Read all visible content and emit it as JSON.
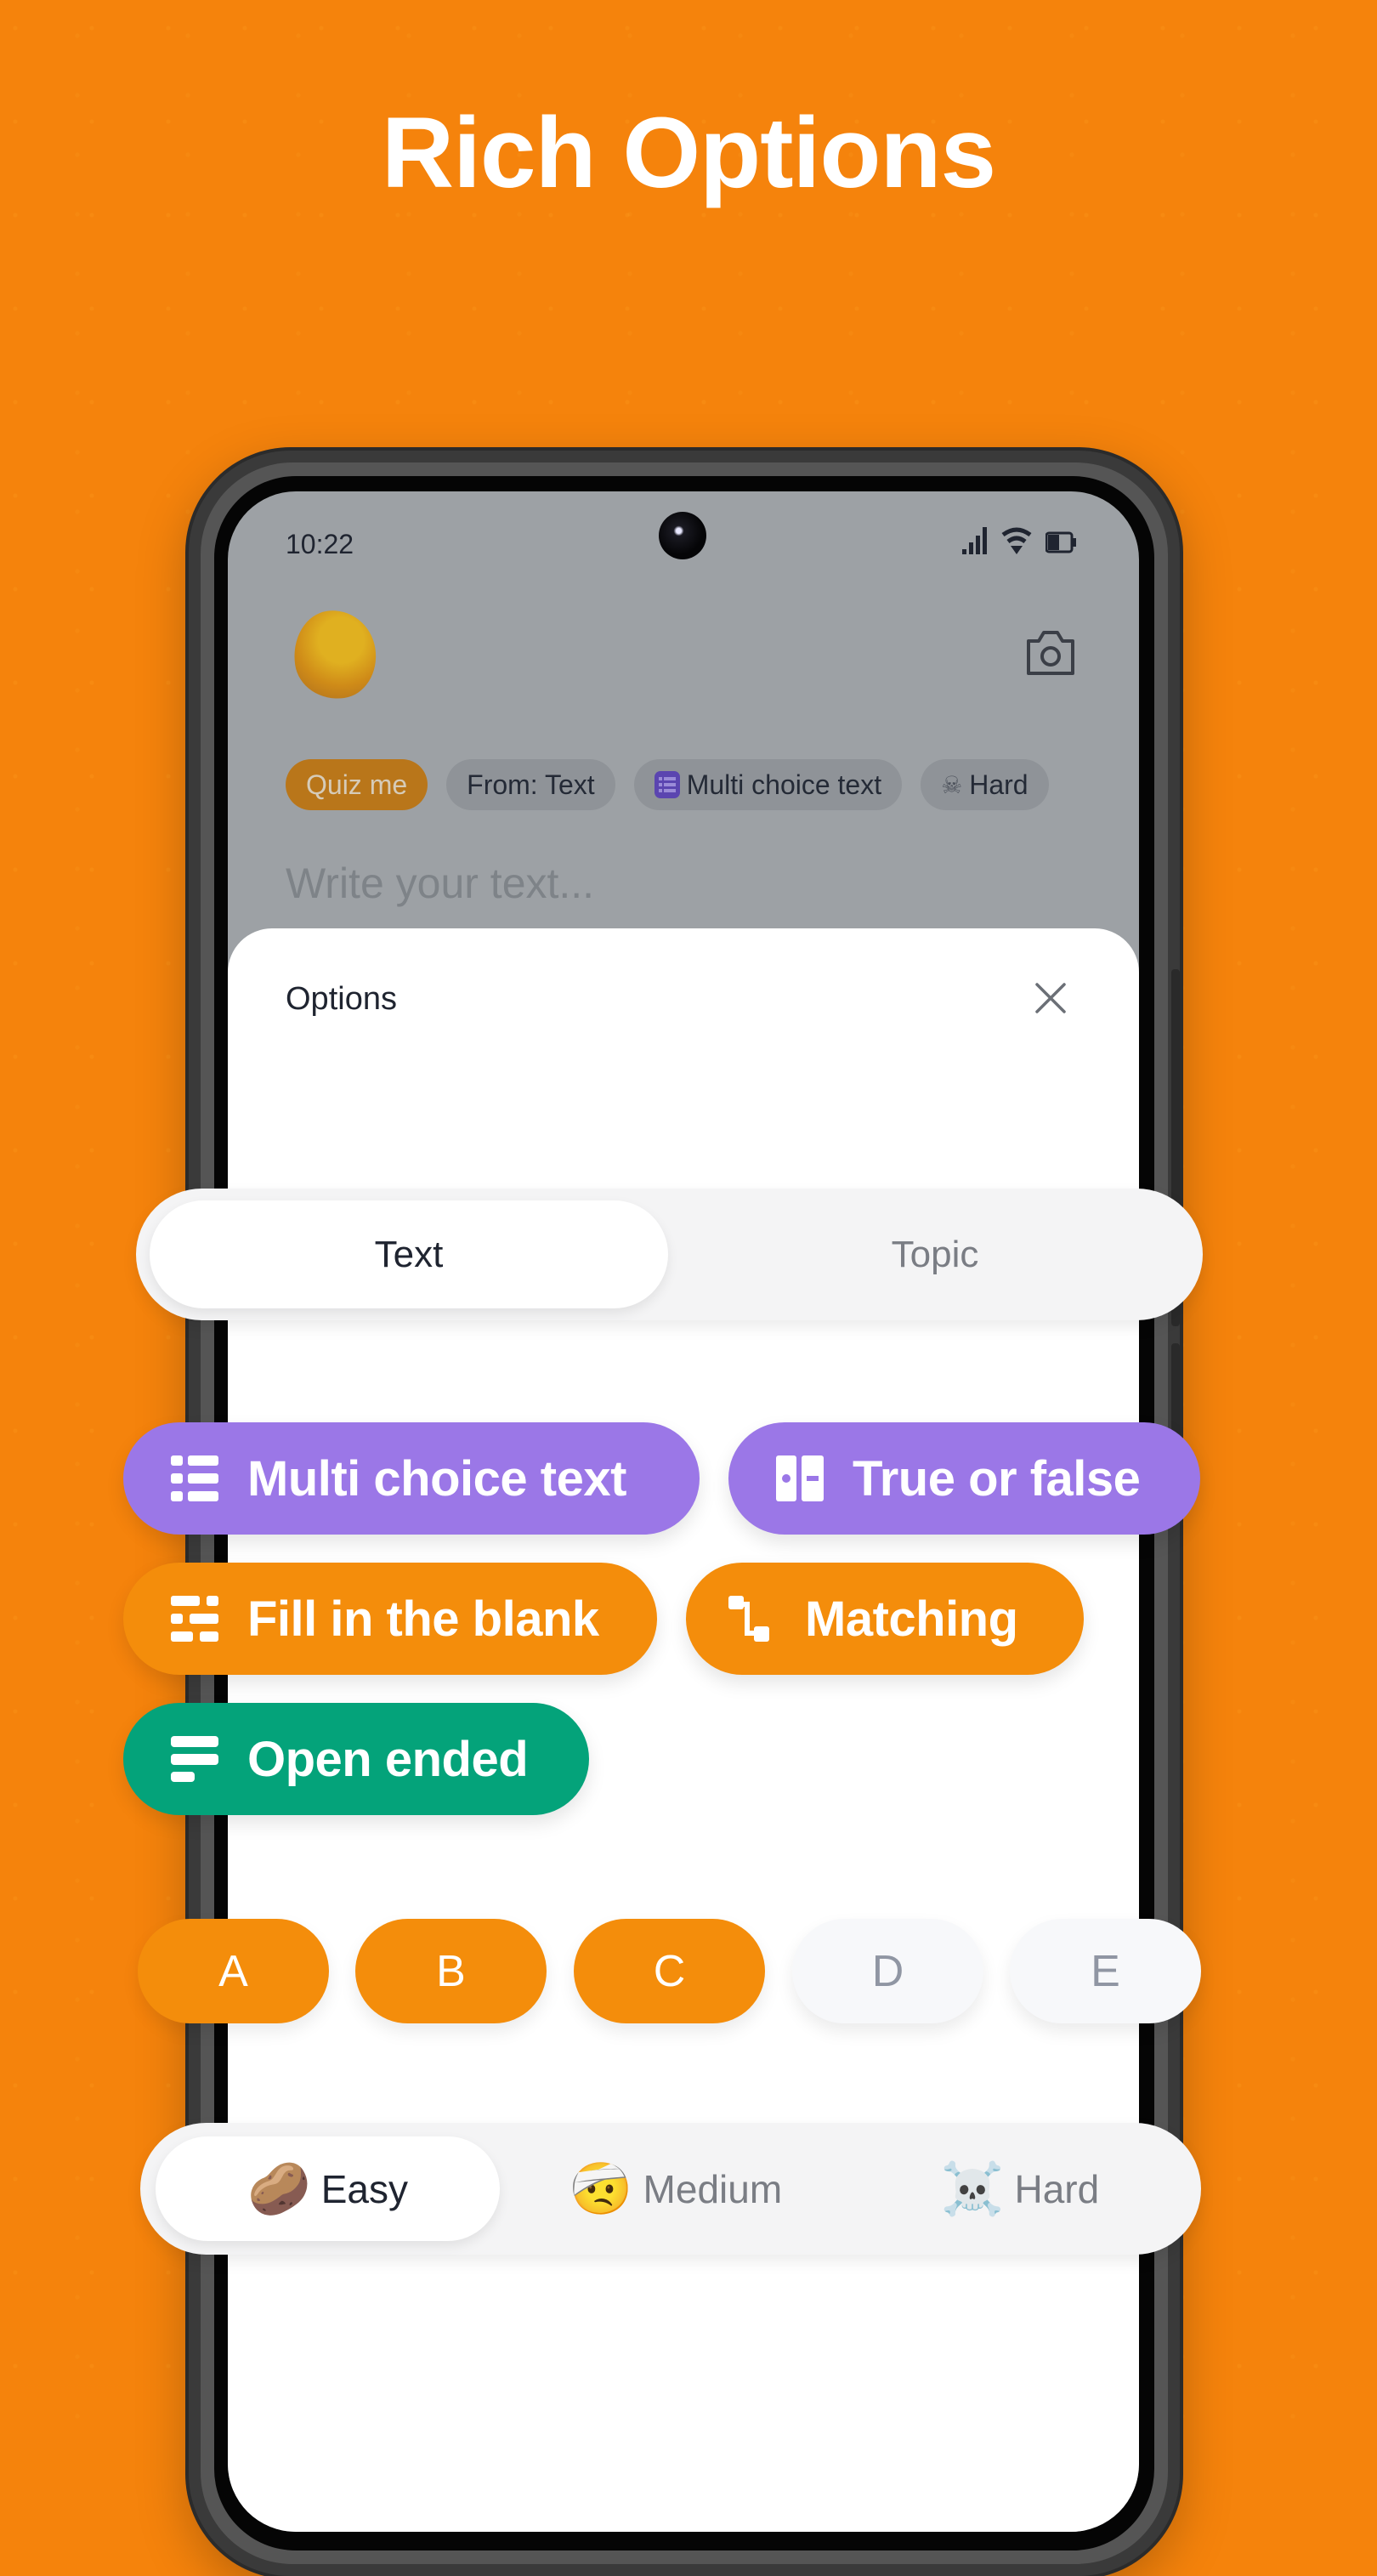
{
  "headline": "Rich Options",
  "colors": {
    "background": "#F5830C",
    "purple": "#9B77E7",
    "orange": "#F48D0B",
    "green": "#04A37A"
  },
  "status_bar": {
    "time": "10:22",
    "icons": [
      "signal-icon",
      "wifi-icon",
      "battery-icon"
    ]
  },
  "header": {
    "avatar": "blob-avatar",
    "camera_icon": "camera-icon"
  },
  "chips": [
    {
      "label": "Quiz me",
      "icon": null
    },
    {
      "label": "From: Text",
      "icon": null
    },
    {
      "label": "Multi choice text",
      "icon": "list-icon"
    },
    {
      "label": "Hard",
      "icon": "skull-crossbones-icon"
    }
  ],
  "editor": {
    "placeholder": "Write your text..."
  },
  "sheet": {
    "title": "Options",
    "close_icon": "close-icon"
  },
  "source_toggle": {
    "options": [
      "Text",
      "Topic"
    ],
    "selected": "Text"
  },
  "question_types": [
    {
      "label": "Multi choice text",
      "icon": "list-icon",
      "color": "#9B77E7"
    },
    {
      "label": "True or false",
      "icon": "toggle-icon",
      "color": "#9B77E7"
    },
    {
      "label": "Fill in the blank",
      "icon": "blanks-icon",
      "color": "#F48D0B"
    },
    {
      "label": "Matching",
      "icon": "connector-icon",
      "color": "#F48D0B"
    },
    {
      "label": "Open ended",
      "icon": "lines-icon",
      "color": "#04A37A"
    }
  ],
  "answer_choices": {
    "options": [
      "A",
      "B",
      "C",
      "D",
      "E"
    ],
    "selected": [
      "A",
      "B",
      "C"
    ]
  },
  "difficulty": {
    "options": [
      {
        "label": "Easy",
        "emoji": "🥔"
      },
      {
        "label": "Medium",
        "emoji": "🤕"
      },
      {
        "label": "Hard",
        "emoji": "☠️"
      }
    ],
    "selected": "Easy"
  }
}
